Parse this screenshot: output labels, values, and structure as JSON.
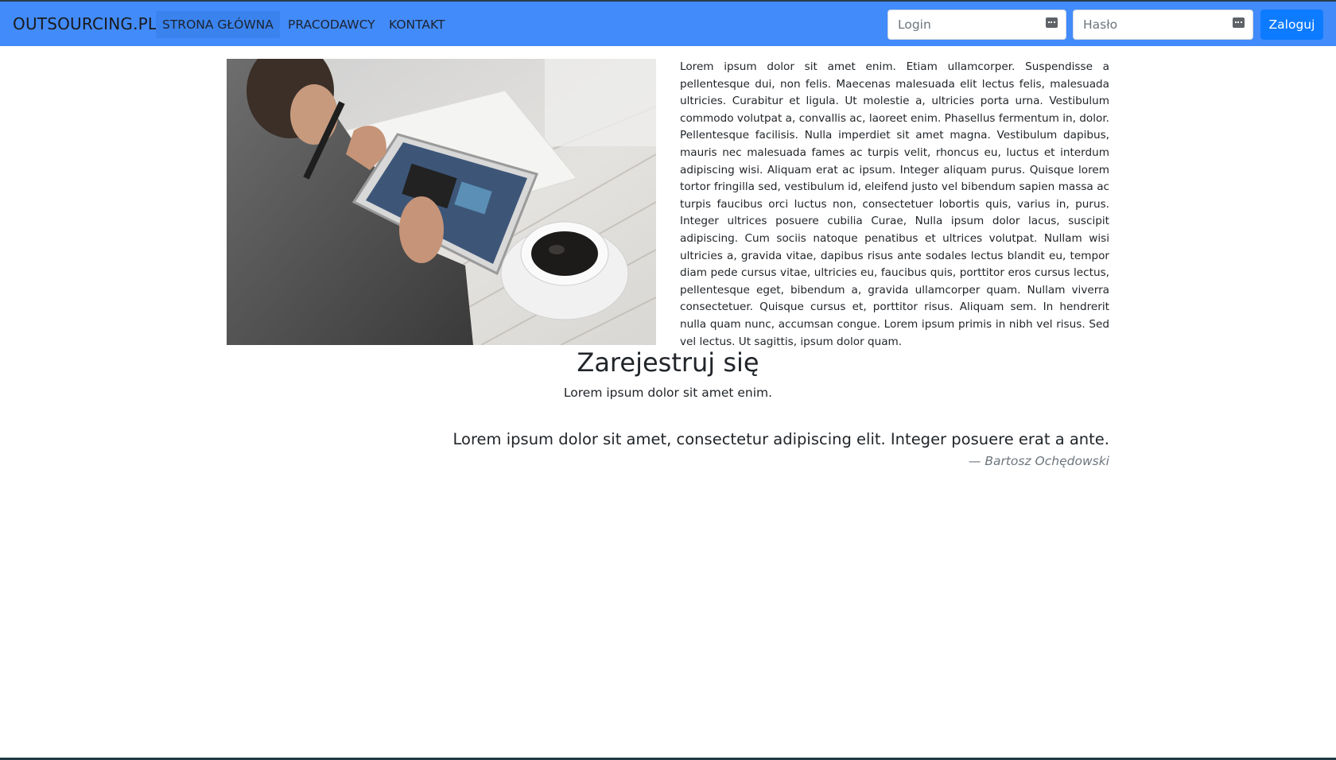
{
  "brand": "OUTSOURCING.PL",
  "nav": {
    "items": [
      {
        "label": "STRONA GŁÓWNA",
        "active": true
      },
      {
        "label": "PRACODAWCY",
        "active": false
      },
      {
        "label": "KONTAKT",
        "active": false
      }
    ]
  },
  "login_form": {
    "login_placeholder": "Login",
    "password_placeholder": "Hasło",
    "login_icon": "password-manager-icon",
    "password_icon": "password-manager-icon",
    "submit_label": "Zaloguj"
  },
  "main": {
    "image_desc_icon": "photo-man-with-tablet-and-coffee",
    "description": "Lorem ipsum dolor sit amet enim. Etiam ullamcorper. Suspendisse a pellentesque dui, non felis. Maecenas malesuada elit lectus felis, malesuada ultricies. Curabitur et ligula. Ut molestie a, ultricies porta urna. Vestibulum commodo volutpat a, convallis ac, laoreet enim. Phasellus fermentum in, dolor. Pellentesque facilisis. Nulla imperdiet sit amet magna. Vestibulum dapibus, mauris nec malesuada fames ac turpis velit, rhoncus eu, luctus et interdum adipiscing wisi. Aliquam erat ac ipsum. Integer aliquam purus. Quisque lorem tortor fringilla sed, vestibulum id, eleifend justo vel bibendum sapien massa ac turpis faucibus orci luctus non, consectetuer lobortis quis, varius in, purus. Integer ultrices posuere cubilia Curae, Nulla ipsum dolor lacus, suscipit adipiscing. Cum sociis natoque penatibus et ultrices volutpat. Nullam wisi ultricies a, gravida vitae, dapibus risus ante sodales lectus blandit eu, tempor diam pede cursus vitae, ultricies eu, faucibus quis, porttitor eros cursus lectus, pellentesque eget, bibendum a, gravida ullamcorper quam. Nullam viverra consectetuer. Quisque cursus et, porttitor risus. Aliquam sem. In hendrerit nulla quam nunc, accumsan congue. Lorem ipsum primis in nibh vel risus. Sed vel lectus. Ut sagittis, ipsum dolor quam."
  },
  "register": {
    "title": "Zarejestruj się",
    "subtitle": "Lorem ipsum dolor sit amet enim."
  },
  "quote": {
    "text": "Lorem ipsum dolor sit amet, consectetur adipiscing elit. Integer posuere erat a ante.",
    "author": "— Bartosz Ochędowski"
  },
  "colors": {
    "navbar": "#428bfa",
    "nav_active": "#3a83ee",
    "button": "#0d7bff"
  }
}
